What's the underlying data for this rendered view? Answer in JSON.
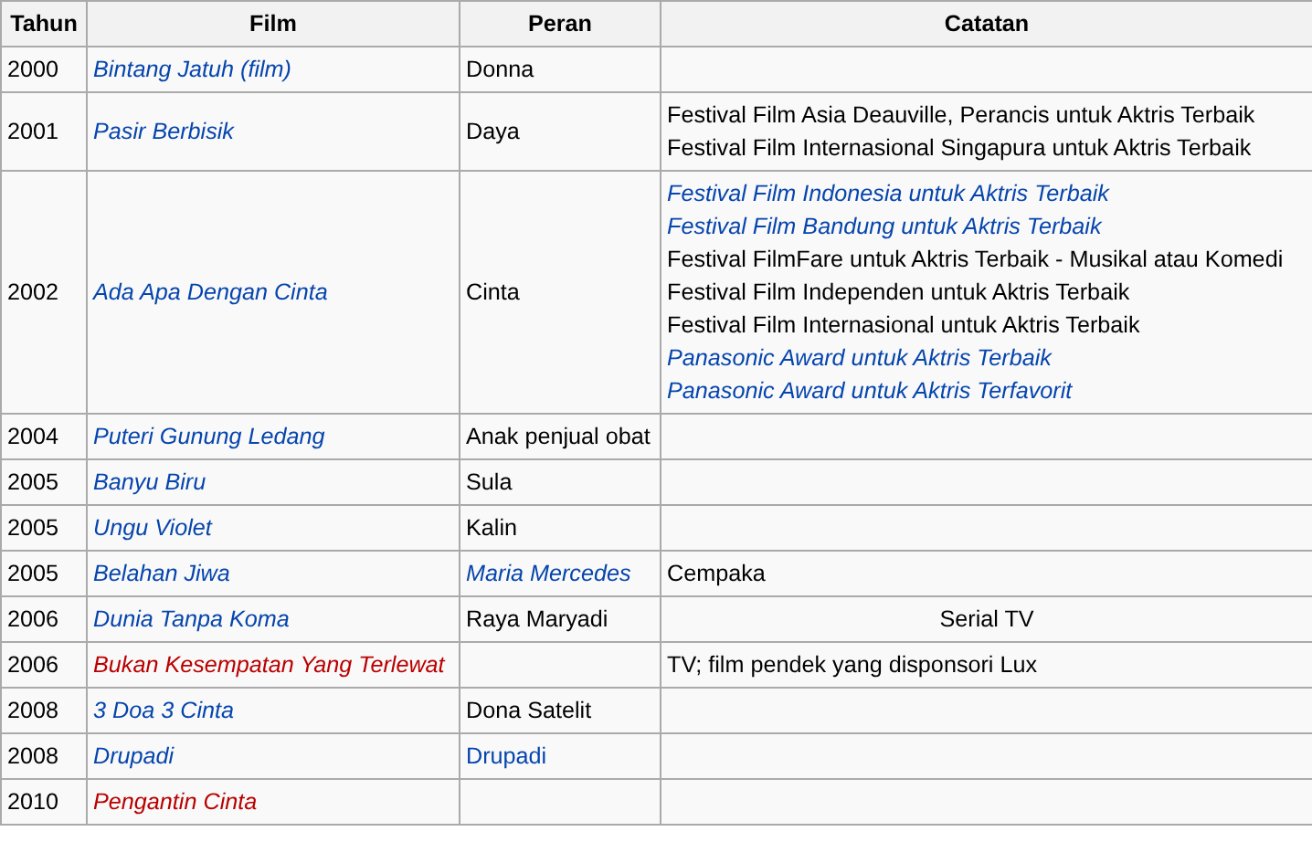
{
  "table": {
    "columns": [
      "Tahun",
      "Film",
      "Peran",
      "Catatan"
    ],
    "rows": [
      {
        "year": "2000",
        "film": {
          "text": "Bintang Jatuh (film)",
          "kind": "link"
        },
        "role": {
          "text": "Donna",
          "kind": "text"
        },
        "notes": []
      },
      {
        "year": "2001",
        "film": {
          "text": "Pasir Berbisik",
          "kind": "link"
        },
        "role": {
          "text": "Daya",
          "kind": "text"
        },
        "notes": [
          {
            "text": "Festival Film Asia Deauville, Perancis untuk Aktris Terbaik",
            "kind": "text"
          },
          {
            "text": "Festival Film Internasional Singapura untuk Aktris Terbaik",
            "kind": "text"
          }
        ]
      },
      {
        "year": "2002",
        "film": {
          "text": "Ada Apa Dengan Cinta",
          "kind": "link"
        },
        "role": {
          "text": "Cinta",
          "kind": "text"
        },
        "notes": [
          {
            "text": "Festival Film Indonesia untuk Aktris Terbaik",
            "kind": "link"
          },
          {
            "text": "Festival Film Bandung untuk Aktris Terbaik",
            "kind": "link"
          },
          {
            "text": "Festival FilmFare untuk Aktris Terbaik - Musikal atau Komedi",
            "kind": "text"
          },
          {
            "text": "Festival Film Independen untuk Aktris Terbaik",
            "kind": "text"
          },
          {
            "text": "Festival Film Internasional untuk Aktris Terbaik",
            "kind": "text"
          },
          {
            "text": "Panasonic Award untuk Aktris Terbaik",
            "kind": "link"
          },
          {
            "text": "Panasonic Award untuk Aktris Terfavorit",
            "kind": "link"
          }
        ]
      },
      {
        "year": "2004",
        "film": {
          "text": "Puteri Gunung Ledang",
          "kind": "link"
        },
        "role": {
          "text": "Anak penjual obat",
          "kind": "text"
        },
        "notes": []
      },
      {
        "year": "2005",
        "film": {
          "text": "Banyu Biru",
          "kind": "link"
        },
        "role": {
          "text": "Sula",
          "kind": "text"
        },
        "notes": []
      },
      {
        "year": "2005",
        "film": {
          "text": "Ungu Violet",
          "kind": "link"
        },
        "role": {
          "text": "Kalin",
          "kind": "text"
        },
        "notes": []
      },
      {
        "year": "2005",
        "film": {
          "text": "Belahan Jiwa",
          "kind": "link"
        },
        "role": {
          "text": "Maria Mercedes",
          "kind": "plainlink"
        },
        "notes": [
          {
            "text": "Cempaka",
            "kind": "text"
          }
        ]
      },
      {
        "year": "2006",
        "film": {
          "text": "Dunia Tanpa Koma",
          "kind": "link"
        },
        "role": {
          "text": "Raya Maryadi",
          "kind": "text"
        },
        "notes": [
          {
            "text": "Serial TV",
            "kind": "centered"
          }
        ]
      },
      {
        "year": "2006",
        "film": {
          "text": "Bukan Kesempatan Yang Terlewat",
          "kind": "redlink"
        },
        "notes": [
          {
            "text": "TV; film pendek yang disponsori Lux",
            "kind": "text"
          }
        ]
      },
      {
        "year": "2008",
        "film": {
          "text": "3 Doa 3 Cinta",
          "kind": "link"
        },
        "role": {
          "text": "Dona Satelit",
          "kind": "text"
        },
        "notes": []
      },
      {
        "year": "2008",
        "film": {
          "text": "Drupadi",
          "kind": "link"
        },
        "role": {
          "text": "Drupadi",
          "kind": "uprightlink"
        },
        "notes": []
      },
      {
        "year": "2010",
        "film": {
          "text": "Pengantin Cinta",
          "kind": "redlink"
        },
        "notes": []
      }
    ]
  }
}
